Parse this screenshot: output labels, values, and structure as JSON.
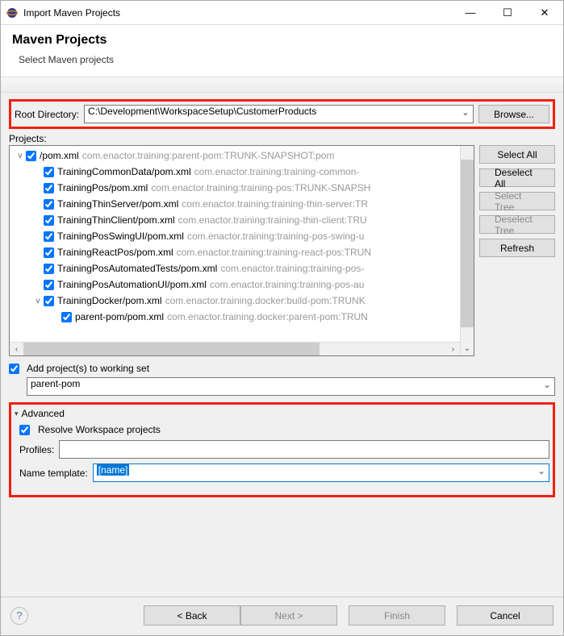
{
  "titlebar": {
    "text": "Import Maven Projects"
  },
  "header": {
    "title": "Maven Projects",
    "subtitle": "Select Maven projects"
  },
  "root_directory": {
    "label": "Root Directory:",
    "value": "C:\\Development\\WorkspaceSetup\\CustomerProducts",
    "browse": "Browse..."
  },
  "projects_label": "Projects:",
  "projects": [
    {
      "indent": 0,
      "expander": "v",
      "name": "/pom.xml",
      "gray": "com.enactor.training:parent-pom:TRUNK-SNAPSHOT:pom"
    },
    {
      "indent": 1,
      "expander": "",
      "name": "TrainingCommonData/pom.xml",
      "gray": "com.enactor.training:training-common-"
    },
    {
      "indent": 1,
      "expander": "",
      "name": "TrainingPos/pom.xml",
      "gray": "com.enactor.training:training-pos:TRUNK-SNAPSH"
    },
    {
      "indent": 1,
      "expander": "",
      "name": "TrainingThinServer/pom.xml",
      "gray": "com.enactor.training:training-thin-server:TR"
    },
    {
      "indent": 1,
      "expander": "",
      "name": "TrainingThinClient/pom.xml",
      "gray": "com.enactor.training:training-thin-client:TRU"
    },
    {
      "indent": 1,
      "expander": "",
      "name": "TrainingPosSwingUI/pom.xml",
      "gray": "com.enactor.training:training-pos-swing-u"
    },
    {
      "indent": 1,
      "expander": "",
      "name": "TrainingReactPos/pom.xml",
      "gray": "com.enactor.training:training-react-pos:TRUN"
    },
    {
      "indent": 1,
      "expander": "",
      "name": "TrainingPosAutomatedTests/pom.xml",
      "gray": "com.enactor.training:training-pos-"
    },
    {
      "indent": 1,
      "expander": "",
      "name": "TrainingPosAutomationUI/pom.xml",
      "gray": "com.enactor.training:training-pos-au"
    },
    {
      "indent": 1,
      "expander": "v",
      "name": "TrainingDocker/pom.xml",
      "gray": "com.enactor.training.docker:build-pom:TRUNK"
    },
    {
      "indent": 2,
      "expander": "",
      "name": "parent-pom/pom.xml",
      "gray": "com.enactor.training.docker:parent-pom:TRUN"
    }
  ],
  "side": {
    "select_all": "Select All",
    "deselect_all": "Deselect All",
    "select_tree": "Select Tree",
    "deselect_tree": "Deselect Tree",
    "refresh": "Refresh"
  },
  "working_set": {
    "add_label": "Add project(s) to working set",
    "value": "parent-pom"
  },
  "advanced": {
    "header": "Advanced",
    "resolve": "Resolve Workspace projects",
    "profiles_label": "Profiles:",
    "profiles_value": "",
    "template_label": "Name template:",
    "template_value": "[name]"
  },
  "nav": {
    "back": "< Back",
    "next": "Next >",
    "finish": "Finish",
    "cancel": "Cancel"
  }
}
